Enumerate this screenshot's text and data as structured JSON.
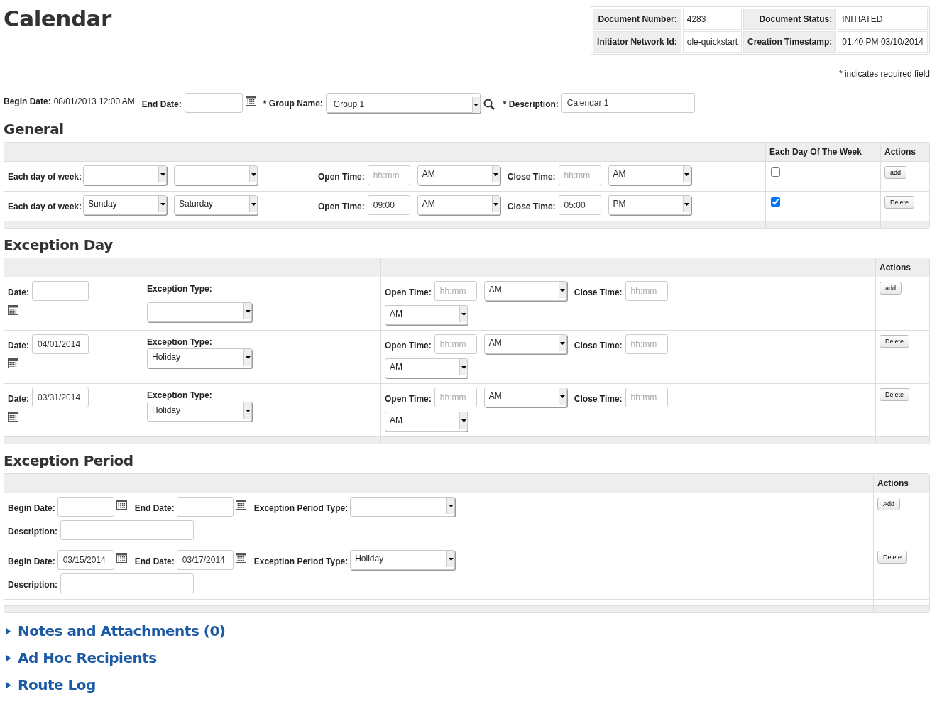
{
  "title": "Calendar",
  "doc_header": [
    [
      {
        "label": "Document Number:",
        "value": "4283"
      },
      {
        "label": "Document Status:",
        "value": "INITIATED"
      }
    ],
    [
      {
        "label": "Initiator Network Id:",
        "value": "ole-quickstart"
      },
      {
        "label": "Creation Timestamp:",
        "value": "01:40 PM 03/10/2014"
      }
    ]
  ],
  "required_note": "* indicates required field",
  "main_fields": {
    "begin_date_label": "Begin Date:",
    "begin_date_value": "08/01/2013 12:00 AM",
    "end_date_label": "End Date:",
    "group_name_label": "* Group Name:",
    "group_name_value": "Group 1",
    "description_label": "* Description:",
    "description_value": "Calendar 1"
  },
  "general": {
    "heading": "General",
    "columns": [
      "Each Day Of The Week",
      "Actions"
    ],
    "rows": [
      {
        "day_label": "Each day of week:",
        "open_label": "Open Time:",
        "open_placeholder": "hh:mm",
        "open_ampm": "AM",
        "close_label": "Close Time:",
        "close_placeholder": "hh:mm",
        "close_ampm": "AM",
        "checked": false,
        "action": "add"
      },
      {
        "day_label": "Each day of week:",
        "from_day": "Sunday",
        "to_day": "Saturday",
        "open_label": "Open Time:",
        "open_time": "09:00",
        "open_ampm": "AM",
        "close_label": "Close Time:",
        "close_time": "05:00",
        "close_ampm": "PM",
        "checked": true,
        "action": "Delete"
      }
    ]
  },
  "exception_day": {
    "heading": "Exception Day",
    "columns": [
      "Actions"
    ],
    "rows": [
      {
        "date_label": "Date:",
        "type_label": "Exception Type:",
        "open_label": "Open Time:",
        "open_placeholder": "hh:mm",
        "open_ampm": "AM",
        "close_label": "Close Time:",
        "close_placeholder": "hh:mm",
        "close_ampm": "AM",
        "action": "add"
      },
      {
        "date_label": "Date:",
        "date": "04/01/2014",
        "type_label": "Exception Type:",
        "type": "Holiday",
        "open_label": "Open Time:",
        "open_placeholder": "hh:mm",
        "open_ampm": "AM",
        "close_label": "Close Time:",
        "close_placeholder": "hh:mm",
        "close_ampm": "AM",
        "action": "Delete"
      },
      {
        "date_label": "Date:",
        "date": "03/31/2014",
        "type_label": "Exception Type:",
        "type": "Holiday",
        "open_label": "Open Time:",
        "open_placeholder": "hh:mm",
        "open_ampm": "AM",
        "close_label": "Close Time:",
        "close_placeholder": "hh:mm",
        "close_ampm": "AM",
        "action": "Delete"
      }
    ]
  },
  "exception_period": {
    "heading": "Exception Period",
    "columns": [
      "Actions"
    ],
    "rows": [
      {
        "begin_label": "Begin Date:",
        "end_label": "End Date:",
        "type_label": "Exception Period Type:",
        "description_label": "Description:",
        "action": "Add"
      },
      {
        "begin_label": "Begin Date:",
        "begin": "03/15/2014",
        "end_label": "End Date:",
        "end": "03/17/2014",
        "type_label": "Exception Period Type:",
        "type": "Holiday",
        "description_label": "Description:",
        "action": "Delete"
      }
    ]
  },
  "sections": [
    {
      "label": "Notes and Attachments (0)",
      "expanded": false
    },
    {
      "label": "Ad Hoc Recipients",
      "expanded": false
    },
    {
      "label": "Route Log",
      "expanded": false
    }
  ]
}
